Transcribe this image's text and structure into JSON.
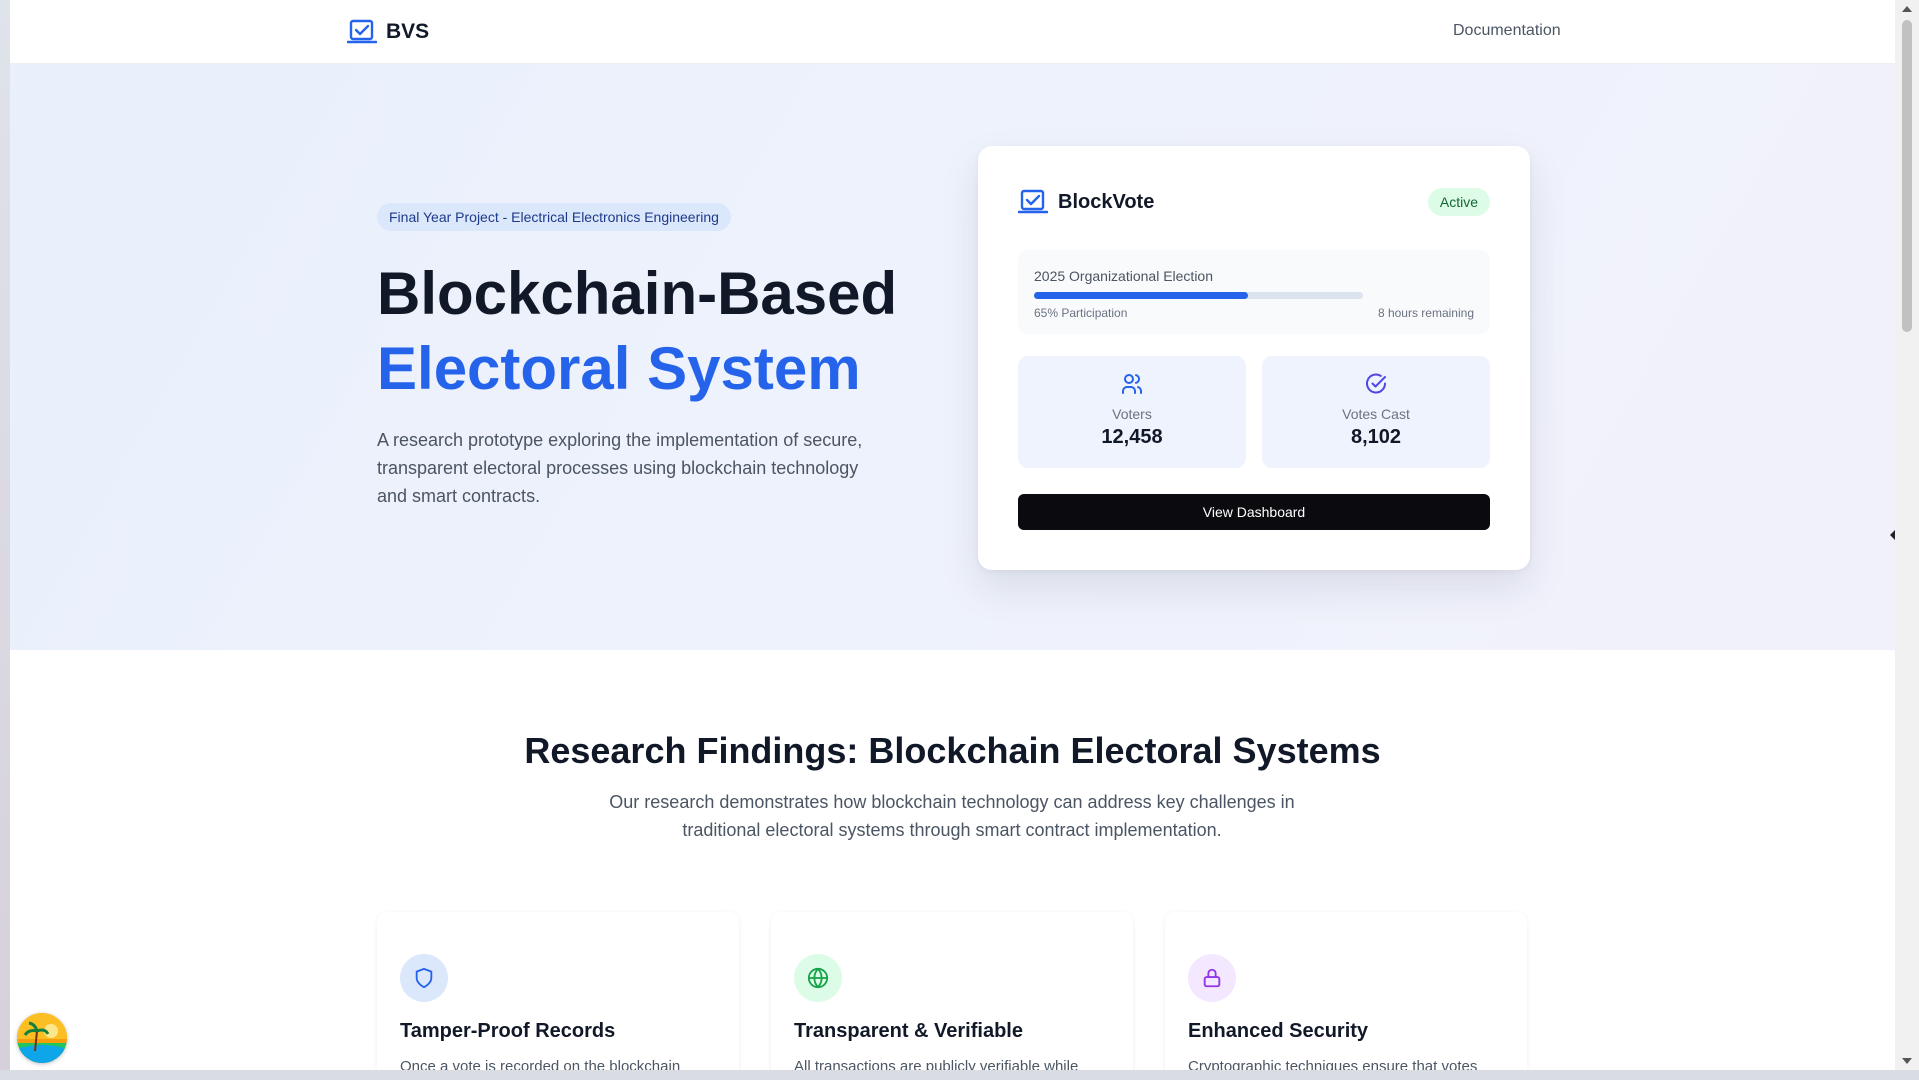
{
  "navbar": {
    "brand": "BVS",
    "links": {
      "documentation": "Documentation"
    }
  },
  "hero": {
    "badge": "Final Year Project - Electrical Electronics Engineering",
    "title_line1": "Blockchain-Based",
    "title_line2": "Electoral System",
    "description": "A research prototype exploring the implementation of secure, transparent electoral processes using blockchain technology and smart contracts."
  },
  "card": {
    "title": "BlockVote",
    "status": "Active",
    "election": {
      "name": "2025 Organizational Election",
      "participation_label": "65% Participation",
      "participation_percent": 65,
      "remaining": "8 hours remaining"
    },
    "stats": [
      {
        "label": "Voters",
        "value": "12,458",
        "icon": "users-icon"
      },
      {
        "label": "Votes Cast",
        "value": "8,102",
        "icon": "check-circle-icon"
      }
    ],
    "button": "View Dashboard"
  },
  "research": {
    "title": "Research Findings: Blockchain Electoral Systems",
    "description": "Our research demonstrates how blockchain technology can address key challenges in traditional electoral systems through smart contract implementation.",
    "features": [
      {
        "title": "Tamper-Proof Records",
        "description": "Once a vote is recorded on the blockchain",
        "icon": "shield-icon"
      },
      {
        "title": "Transparent & Verifiable",
        "description": "All transactions are publicly verifiable while",
        "icon": "globe-icon"
      },
      {
        "title": "Enhanced Security",
        "description": "Cryptographic techniques ensure that votes",
        "icon": "lock-icon"
      }
    ]
  },
  "colors": {
    "accent": "#2563eb",
    "status_active_bg": "#dcfce7",
    "button_bg": "#0b0b0f"
  }
}
